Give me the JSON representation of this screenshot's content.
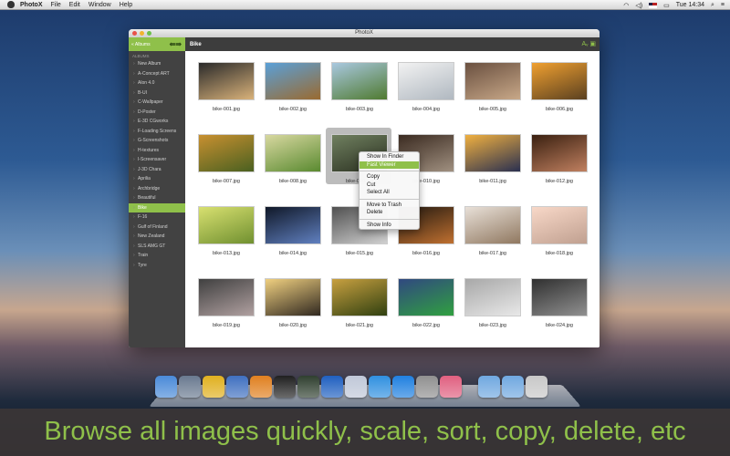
{
  "menubar": {
    "app_name": "PhotoX",
    "items": [
      "File",
      "Edit",
      "Window",
      "Help"
    ],
    "clock": "Tue 14:34"
  },
  "window": {
    "title": "PhotoX",
    "toolbar": {
      "album_button": "« Albums",
      "arrows": "⇚⇛",
      "breadcrumb": "Bike",
      "tools": "Aᵥ ▣"
    }
  },
  "sidebar": {
    "heading": "ALBUMS",
    "items": [
      "New Album",
      "A-Concept ART",
      "Alon 4.0",
      "B-UI",
      "C-Wallpaper",
      "D-Poster",
      "E-3D CGworks",
      "F-Loading Screens",
      "G-Screenshots",
      "H-textures",
      "I-Screensaver",
      "J-3D Chara",
      "Aprilia",
      "Archbridge",
      "Beautiful",
      "Bike",
      "F-16",
      "Gulf of Finland",
      "New Zealand",
      "SLS AMG GT",
      "Train",
      "Tyre"
    ],
    "selected_index": 15
  },
  "grid": {
    "images": [
      {
        "name": "bike-001.jpg",
        "colors": [
          "#2a2a2a",
          "#d9b27a"
        ]
      },
      {
        "name": "bike-002.jpg",
        "colors": [
          "#5aa0d8",
          "#9a6a30"
        ]
      },
      {
        "name": "bike-003.jpg",
        "colors": [
          "#a9c8e0",
          "#4f7a30"
        ]
      },
      {
        "name": "bike-004.jpg",
        "colors": [
          "#f2f2f2",
          "#b0b8c0"
        ]
      },
      {
        "name": "bike-005.jpg",
        "colors": [
          "#6a5040",
          "#c8a888"
        ]
      },
      {
        "name": "bike-006.jpg",
        "colors": [
          "#f0a030",
          "#5a4020"
        ]
      },
      {
        "name": "bike-007.jpg",
        "colors": [
          "#c89030",
          "#4a6020"
        ]
      },
      {
        "name": "bike-008.jpg",
        "colors": [
          "#d8d8a0",
          "#5a8a30"
        ]
      },
      {
        "name": "bike-009.jpg",
        "colors": [
          "#708060",
          "#2a3020"
        ]
      },
      {
        "name": "bike-010.jpg",
        "colors": [
          "#3a2a20",
          "#a09080"
        ]
      },
      {
        "name": "bike-011.jpg",
        "colors": [
          "#f0b040",
          "#2a3050"
        ]
      },
      {
        "name": "bike-012.jpg",
        "colors": [
          "#3a2010",
          "#c08060"
        ]
      },
      {
        "name": "bike-013.jpg",
        "colors": [
          "#d8e070",
          "#709030"
        ]
      },
      {
        "name": "bike-014.jpg",
        "colors": [
          "#101828",
          "#6080c0"
        ]
      },
      {
        "name": "bike-015.jpg",
        "colors": [
          "#505050",
          "#d0d0d0"
        ]
      },
      {
        "name": "bike-016.jpg",
        "colors": [
          "#201810",
          "#c07030"
        ]
      },
      {
        "name": "bike-017.jpg",
        "colors": [
          "#e8e0d8",
          "#907860"
        ]
      },
      {
        "name": "bike-018.jpg",
        "colors": [
          "#f8d8c8",
          "#c0a090"
        ]
      },
      {
        "name": "bike-019.jpg",
        "colors": [
          "#404040",
          "#b0a0a0"
        ]
      },
      {
        "name": "bike-020.jpg",
        "colors": [
          "#f0d080",
          "#302820"
        ]
      },
      {
        "name": "bike-021.jpg",
        "colors": [
          "#c8a040",
          "#304010"
        ]
      },
      {
        "name": "bike-022.jpg",
        "colors": [
          "#304880",
          "#30a040"
        ]
      },
      {
        "name": "bike-023.jpg",
        "colors": [
          "#a8a8a8",
          "#e8e8e8"
        ]
      },
      {
        "name": "bike-024.jpg",
        "colors": [
          "#303030",
          "#909090"
        ]
      }
    ],
    "highlighted_index": 8
  },
  "context_menu": {
    "items": [
      {
        "label": "Show In Finder"
      },
      {
        "label": "Fast Viewer",
        "active": true
      },
      {
        "separator": true
      },
      {
        "label": "Copy"
      },
      {
        "label": "Cut"
      },
      {
        "label": "Select All"
      },
      {
        "separator": true
      },
      {
        "label": "Move to Trash"
      },
      {
        "label": "Delete"
      },
      {
        "separator": true
      },
      {
        "label": "Show Info"
      }
    ]
  },
  "dock": {
    "icons": [
      {
        "name": "finder-icon",
        "color": "#4a8ad8"
      },
      {
        "name": "launchpad-icon",
        "color": "#6a7a90"
      },
      {
        "name": "chrome-icon",
        "color": "#e0b020"
      },
      {
        "name": "xcode-icon",
        "color": "#4070c0"
      },
      {
        "name": "sublime-icon",
        "color": "#e08020"
      },
      {
        "name": "terminal-icon",
        "color": "#202020"
      },
      {
        "name": "activity-monitor-icon",
        "color": "#304030"
      },
      {
        "name": "word-icon",
        "color": "#2060c0"
      },
      {
        "name": "preview-icon",
        "color": "#c0c8d8"
      },
      {
        "name": "itunes-icon",
        "color": "#3090e0"
      },
      {
        "name": "app-store-icon",
        "color": "#2080e0"
      },
      {
        "name": "system-preferences-icon",
        "color": "#909090"
      },
      {
        "name": "photox-icon",
        "color": "#e06080"
      },
      {
        "gap": true
      },
      {
        "name": "downloads-folder-icon",
        "color": "#70a8e0"
      },
      {
        "name": "documents-folder-icon",
        "color": "#70a8e0"
      },
      {
        "name": "trash-icon",
        "color": "#c8c8c8"
      }
    ]
  },
  "caption": "Browse all images quickly, scale, sort, copy, delete, etc"
}
